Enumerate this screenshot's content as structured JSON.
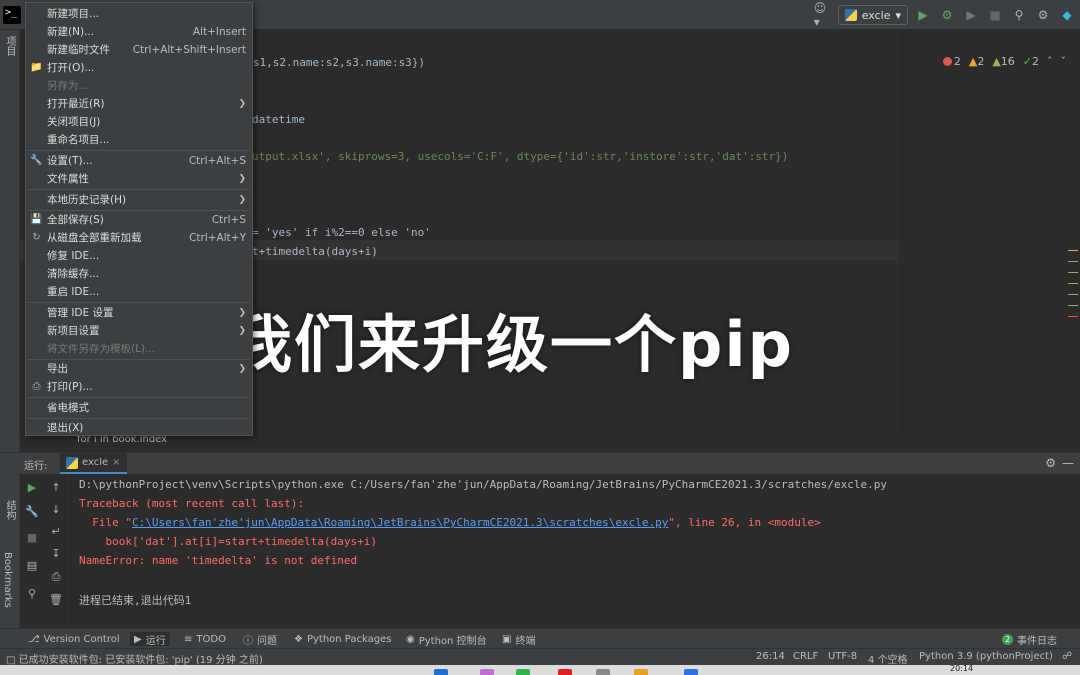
{
  "toolbar": {
    "run_config": "excle",
    "icons": [
      "user-icon",
      "python-icon",
      "run-icon",
      "debug-icon",
      "coverage-icon",
      "stop-icon",
      "search-icon",
      "settings-icon",
      "jetbrains-icon"
    ]
  },
  "left_strip": {
    "project_label": "项目",
    "structure_label": "结构",
    "bookmarks_label": "Bookmarks"
  },
  "menu": {
    "items": [
      {
        "label": "新建项目...",
        "shortcut": "",
        "disabled": false
      },
      {
        "label": "新建(N)...",
        "shortcut": "Alt+Insert",
        "disabled": false
      },
      {
        "label": "新建临时文件",
        "shortcut": "Ctrl+Alt+Shift+Insert",
        "disabled": false
      },
      {
        "label": "打开(O)...",
        "shortcut": "",
        "disabled": false,
        "icon": "folder-icon"
      },
      {
        "label": "另存为...",
        "shortcut": "",
        "disabled": true
      },
      {
        "label": "打开最近(R)",
        "shortcut": "",
        "disabled": false,
        "submenu": true
      },
      {
        "label": "关闭项目(J)",
        "shortcut": "",
        "disabled": false
      },
      {
        "label": "重命名项目...",
        "shortcut": "",
        "disabled": false
      },
      {
        "label": "设置(T)...",
        "shortcut": "Ctrl+Alt+S",
        "disabled": false,
        "icon": "wrench-icon"
      },
      {
        "label": "文件属性",
        "shortcut": "",
        "disabled": false,
        "submenu": true
      },
      {
        "label": "本地历史记录(H)",
        "shortcut": "",
        "disabled": false,
        "submenu": true
      },
      {
        "label": "全部保存(S)",
        "shortcut": "Ctrl+S",
        "disabled": false,
        "icon": "save-icon"
      },
      {
        "label": "从磁盘全部重新加载",
        "shortcut": "Ctrl+Alt+Y",
        "disabled": false,
        "icon": "reload-icon"
      },
      {
        "label": "修复 IDE...",
        "shortcut": "",
        "disabled": false
      },
      {
        "label": "清除缓存...",
        "shortcut": "",
        "disabled": false
      },
      {
        "label": "重启 IDE...",
        "shortcut": "",
        "disabled": false
      },
      {
        "label": "管理 IDE 设置",
        "shortcut": "",
        "disabled": false,
        "submenu": true
      },
      {
        "label": "新项目设置",
        "shortcut": "",
        "disabled": false,
        "submenu": true
      },
      {
        "label": "将文件另存为模板(L)...",
        "shortcut": "",
        "disabled": true
      },
      {
        "label": "导出",
        "shortcut": "",
        "disabled": false,
        "submenu": true
      },
      {
        "label": "打印(P)...",
        "shortcut": "",
        "disabled": false,
        "icon": "print-icon"
      },
      {
        "label": "省电模式",
        "shortcut": "",
        "disabled": false
      },
      {
        "label": "退出(X)",
        "shortcut": "",
        "disabled": false
      }
    ]
  },
  "editor": {
    "lines": [
      "me:s1,s2.name:s2,s3.name:s3})",
      "datetime",
      "utput.xlsx', skiprows=3, usecols='C:F', dtype={'id':str,'instore':str,'dat':str})",
      "= 'yes' if i%2==0 else 'no'",
      "t+timedelta(days+i)"
    ],
    "breadcrumb": "for i in book.index",
    "inspections": {
      "errors": "2",
      "warnings": "2",
      "weak": "16",
      "ok": "2"
    }
  },
  "caption": "我们来升级一个pip",
  "run_panel": {
    "label": "运行:",
    "tab": "excle",
    "console": [
      "D:\\pythonProject\\venv\\Scripts\\python.exe C:/Users/fan'zhe'jun/AppData/Roaming/JetBrains/PyCharmCE2021.3/scratches/excle.py",
      "Traceback (most recent call last):",
      "  File \"",
      "C:\\Users\\fan'zhe'jun\\AppData\\Roaming\\JetBrains\\PyCharmCE2021.3\\scratches\\excle.py",
      "\", line 26, in <module>",
      "    book['dat'].at[i]=start+timedelta(days+i)",
      "NameError: name 'timedelta' is not defined",
      "进程已结束,退出代码1"
    ]
  },
  "tool_windows": {
    "version_control": "Version Control",
    "run": "运行",
    "todo": "TODO",
    "problems": "问题",
    "packages": "Python Packages",
    "console": "Python 控制台",
    "terminal": "终端",
    "event_log": "事件日志",
    "event_count": "2"
  },
  "status": {
    "message": "已成功安装软件包: 已安装软件包: 'pip' (19 分钟 之前)",
    "position": "26:14",
    "line_sep": "CRLF",
    "encoding": "UTF-8",
    "indent": "4 个空格",
    "interpreter": "Python 3.9 (pythonProject)",
    "clock": "20:14"
  }
}
